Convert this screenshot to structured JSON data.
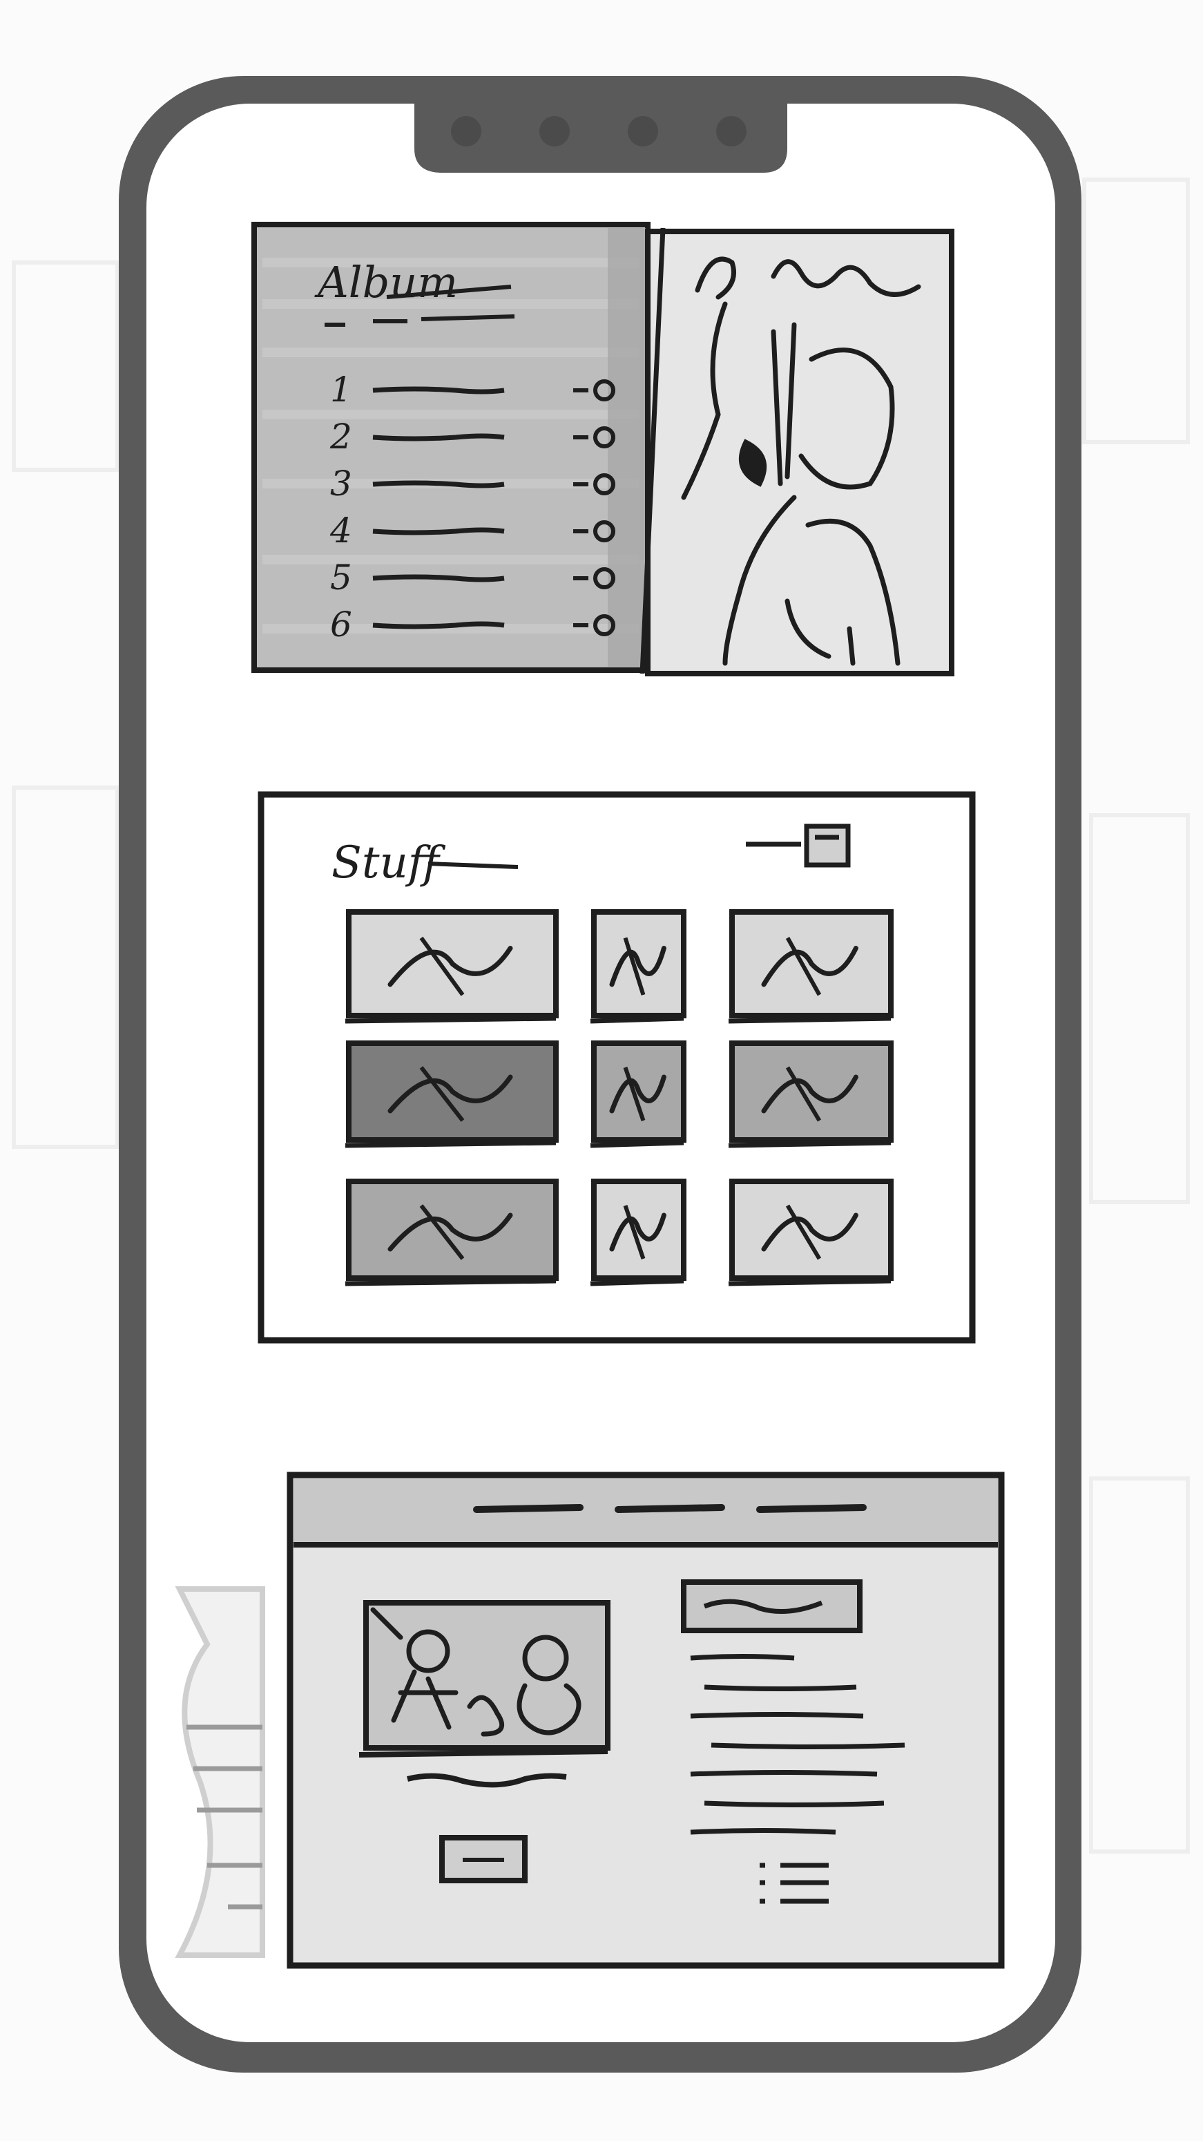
{
  "colors": {
    "phone_frame": "#555555",
    "phone_screen": "#ffffff",
    "ink": "#1e1e1e",
    "grey_fill": "#bdbdbd",
    "light_fill": "#e4e4e4",
    "dark_fill": "#777777"
  },
  "phone": {
    "camera_dots": 4
  },
  "album_screen": {
    "title_scribble": "Album",
    "track_numbers": [
      "1",
      "2",
      "3",
      "4",
      "5",
      "6"
    ],
    "cover_art": "sketched-portrait-icon"
  },
  "gallery_screen": {
    "title_scribble": "Stuff",
    "grid_rows": 3,
    "grid_cols": 3,
    "thumbnails": [
      {
        "shade": "light"
      },
      {
        "shade": "light"
      },
      {
        "shade": "light"
      },
      {
        "shade": "dark"
      },
      {
        "shade": "mid"
      },
      {
        "shade": "mid"
      },
      {
        "shade": "mid"
      },
      {
        "shade": "light"
      },
      {
        "shade": "light"
      }
    ]
  },
  "detail_screen": {
    "nav_dashes": 3,
    "image": "sketched-figures-icon",
    "right_column_lines": 7
  }
}
